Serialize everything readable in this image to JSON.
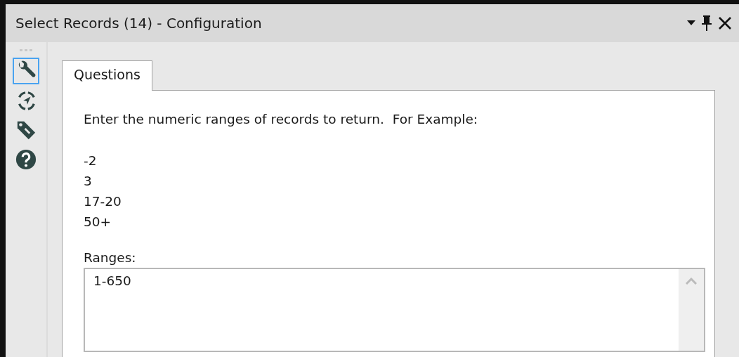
{
  "window": {
    "title": "Select Records (14) - Configuration"
  },
  "sidebar": {
    "items": [
      {
        "kind": "wrench",
        "selected": true
      },
      {
        "kind": "target",
        "selected": false
      },
      {
        "kind": "tag",
        "selected": false
      },
      {
        "kind": "help",
        "selected": false
      }
    ]
  },
  "tabs": [
    {
      "label": "Questions",
      "selected": true
    }
  ],
  "instructions": "Enter the numeric ranges of records to return.  For Example:",
  "examples": [
    "-2",
    "3",
    "17-20",
    "50+"
  ],
  "ranges": {
    "label": "Ranges:",
    "value": "1-650"
  }
}
